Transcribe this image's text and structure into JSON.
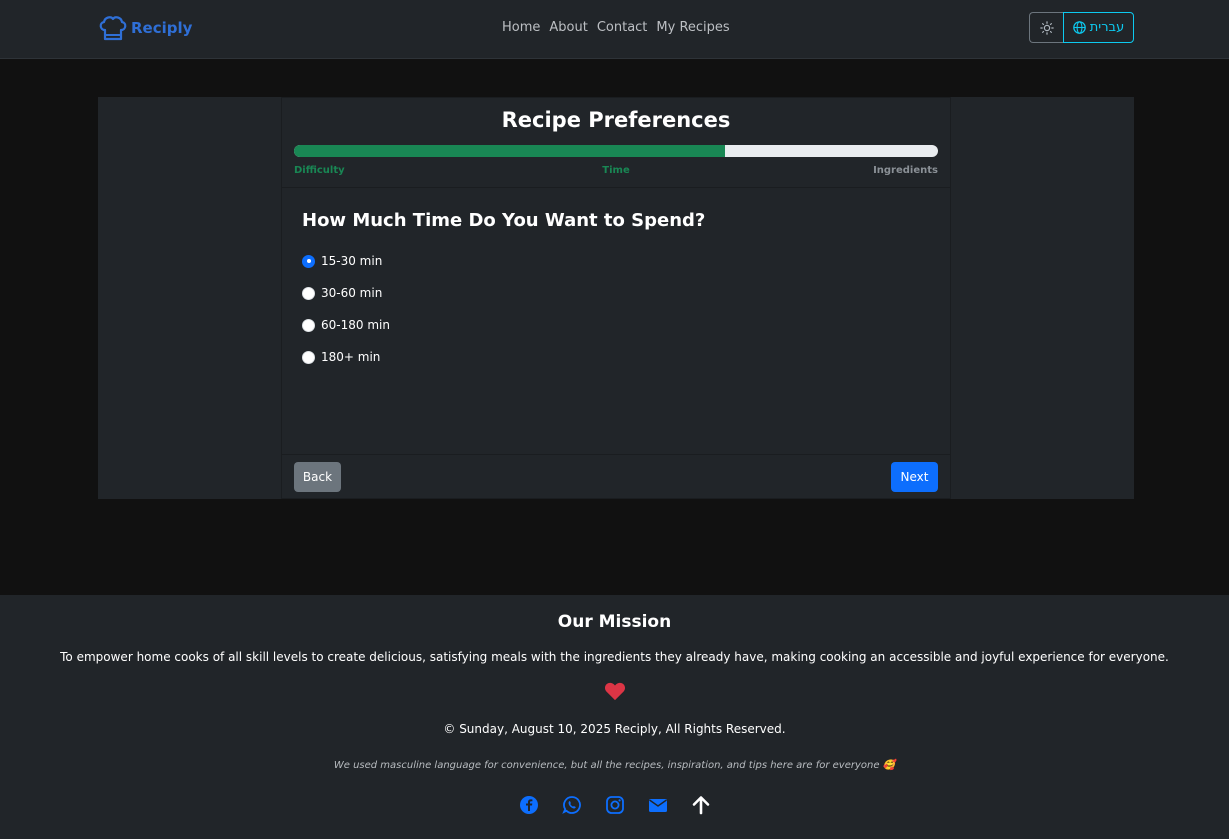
{
  "nav": {
    "brand": "Reciply",
    "links": [
      "Home",
      "About",
      "Contact",
      "My Recipes"
    ],
    "language_button": "עברית",
    "theme_icon": "sun-icon",
    "language_icon": "globe-icon"
  },
  "wizard": {
    "title": "Recipe Preferences",
    "progress": 0.67,
    "steps": [
      "Difficulty",
      "Time",
      "Ingredients"
    ],
    "question": "How Much Time Do You Want to Spend?",
    "options": [
      "15-30 min",
      "30-60 min",
      "60-180 min",
      "180+ min"
    ],
    "selected": "15-30 min",
    "back_label": "Back",
    "next_label": "Next"
  },
  "footer": {
    "mission_title": "Our Mission",
    "mission_text": "To empower home cooks of all skill levels to create delicious, satisfying meals with the ingredients they already have, making cooking an accessible and joyful experience for everyone.",
    "copyright": "© Sunday, August 10, 2025 Reciply, All Rights Reserved.",
    "disclaimer": "We used masculine language for convenience, but all the recipes, inspiration, and tips here are for everyone 🥰",
    "socials": [
      "facebook-icon",
      "whatsapp-icon",
      "instagram-icon",
      "email-icon",
      "arrow-up-icon"
    ]
  },
  "colors": {
    "accent": "#0d6efd",
    "progress": "#198754",
    "heart": "#dc3545",
    "language": "#0dcaf0"
  }
}
